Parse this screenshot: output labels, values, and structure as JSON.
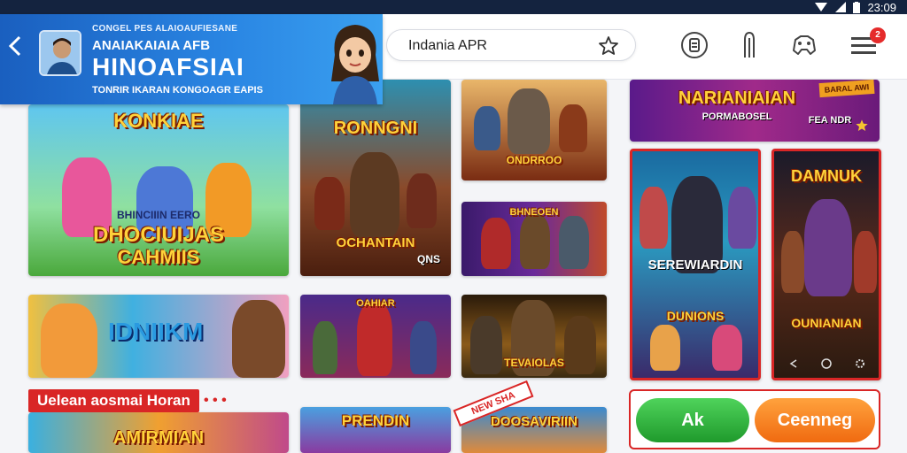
{
  "status_bar": {
    "time": "23:09"
  },
  "header": {
    "small_text": "CONGEL PES ALAIOAUFIESANE",
    "subtitle": "ANAIAKAIAIA AFB",
    "title": "HINOAFSIAI",
    "caption": "TONRIR IKARAN KONGOAGR EAPIS"
  },
  "search": {
    "value": "Indania APR"
  },
  "notification_badge": "2",
  "cards": {
    "c1": {
      "title": "KONKIAE",
      "subtitle": "DHOCIUIJAS",
      "subtitle2": "CAHMIIS",
      "tagline": "BHINCIIIN EERO"
    },
    "c2": {
      "title": "RONNGNI",
      "subtitle": "OCHANTAIN",
      "corner": "QNS"
    },
    "c3": {
      "title": "ONDRROO"
    },
    "c4": {
      "title": "BHNEOEN"
    },
    "c5": {
      "title": "NARIANIAIAN",
      "subtitle": "PORMABOSEL",
      "badge": "BARAL AWI",
      "tag": "FEA NDR"
    },
    "c6": {
      "title": "SEREWIARDIN",
      "subtitle": "DUNIONS"
    },
    "c7": {
      "title": "DAMNUK",
      "subtitle": "OUNIANIAN"
    },
    "c8": {
      "title": "IDNIIKM"
    },
    "c9": {
      "title": "OAHIAR"
    },
    "c10": {
      "title": "TEVAIOLAS"
    },
    "c11": {
      "title": "AMIRMIAN"
    },
    "c12": {
      "title": "PRENDIN"
    },
    "c13": {
      "title": "DOOSAVIRIIN"
    }
  },
  "section_title": "Uelean aosmai Horan",
  "section_dots": "• • •",
  "sale_tag": "NEW SHA",
  "actions": {
    "primary": "Ak",
    "secondary": "Ceenneg"
  },
  "colors": {
    "accent_blue": "#1a5fbf",
    "accent_red": "#d92626",
    "green": "#1f9a2c",
    "orange": "#f06a10"
  }
}
